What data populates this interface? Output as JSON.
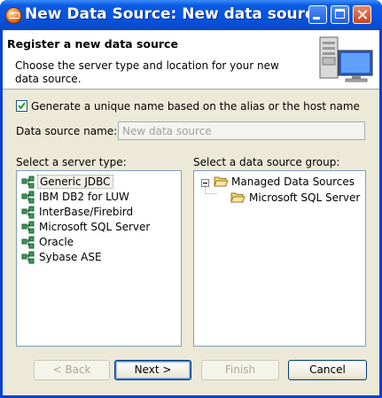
{
  "window": {
    "title": "New Data Source: New data source"
  },
  "header": {
    "title": "Register a new data source",
    "description": "Choose the server type and location for your new data source.",
    "graphic": "server-computer-icon"
  },
  "options": {
    "generate_unique_name": {
      "label": "Generate a unique name based on the alias or the host name",
      "checked": true
    }
  },
  "data_source_name": {
    "label": "Data source name:",
    "value": "New data source"
  },
  "server_types": {
    "label": "Select a server type:",
    "selected": "Generic JDBC",
    "items": [
      "Generic JDBC",
      "IBM DB2 for LUW",
      "InterBase/Firebird",
      "Microsoft SQL Server",
      "Oracle",
      "Sybase ASE"
    ]
  },
  "data_source_group": {
    "label": "Select a data source group:",
    "root": {
      "label": "Managed Data Sources",
      "expanded": true
    },
    "children": [
      "Microsoft SQL Server"
    ]
  },
  "buttons": {
    "back": "< Back",
    "next": "Next >",
    "finish": "Finish",
    "cancel": "Cancel"
  }
}
